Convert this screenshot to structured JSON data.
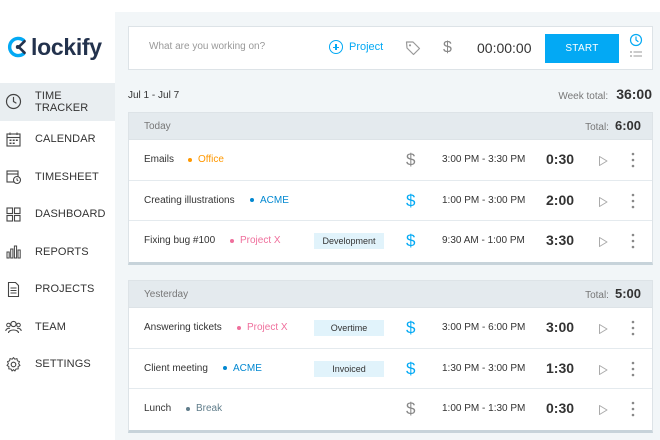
{
  "brand": {
    "logo_text": "lockify"
  },
  "sidebar": {
    "items": [
      {
        "label": "TIME TRACKER",
        "icon": "clock-icon",
        "active": true
      },
      {
        "label": "CALENDAR",
        "icon": "calendar-icon"
      },
      {
        "label": "TIMESHEET",
        "icon": "timesheet-icon"
      },
      {
        "label": "DASHBOARD",
        "icon": "dashboard-icon"
      },
      {
        "label": "REPORTS",
        "icon": "reports-icon"
      },
      {
        "label": "PROJECTS",
        "icon": "projects-icon"
      },
      {
        "label": "TEAM",
        "icon": "team-icon"
      },
      {
        "label": "SETTINGS",
        "icon": "settings-icon"
      }
    ]
  },
  "timer": {
    "placeholder": "What are you working on?",
    "project_label": "Project",
    "dollar": "$",
    "time": "00:00:00",
    "start_label": "START"
  },
  "summary": {
    "date_range": "Jul 1 - Jul 7",
    "week_total_label": "Week total:",
    "week_total": "36:00"
  },
  "groups": [
    {
      "day": "Today",
      "total_label": "Total:",
      "total": "6:00",
      "entries": [
        {
          "description": "Emails",
          "project": "Office",
          "tag": "",
          "billable": false,
          "time_range": "3:00 PM - 3:30 PM",
          "duration": "0:30"
        },
        {
          "description": "Creating illustrations",
          "project": "ACME",
          "tag": "",
          "billable": true,
          "time_range": "1:00 PM - 3:00 PM",
          "duration": "2:00"
        },
        {
          "description": "Fixing bug #100",
          "project": "Project X",
          "tag": "Development",
          "billable": true,
          "time_range": "9:30 AM - 1:00 PM",
          "duration": "3:30"
        }
      ]
    },
    {
      "day": "Yesterday",
      "total_label": "Total:",
      "total": "5:00",
      "entries": [
        {
          "description": "Answering tickets",
          "project": "Project X",
          "tag": "Overtime",
          "billable": true,
          "time_range": "3:00 PM - 6:00 PM",
          "duration": "3:00"
        },
        {
          "description": "Client meeting",
          "project": "ACME",
          "tag": "Invoiced",
          "billable": true,
          "time_range": "1:30 PM - 3:00 PM",
          "duration": "1:30"
        },
        {
          "description": "Lunch",
          "project": "Break",
          "tag": "",
          "billable": false,
          "time_range": "1:00 PM - 1:30 PM",
          "duration": "0:30"
        }
      ]
    }
  ],
  "colors": {
    "accent": "#03a9f4",
    "brand_dark": "#23324d",
    "billable": "#03a9f4",
    "non_billable": "#888888",
    "projects": {
      "Office": "#ff9800",
      "ACME": "#0288d1",
      "Project X": "#ef6f9c",
      "Break": "#607d8b"
    }
  }
}
